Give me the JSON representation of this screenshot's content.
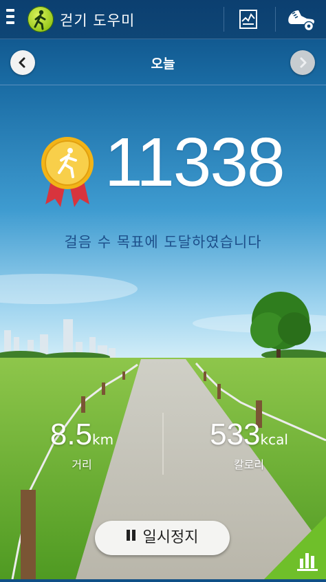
{
  "app": {
    "title": "걷기 도우미"
  },
  "header": {
    "icons": [
      "menu-icon",
      "walker-logo-icon",
      "report-icon",
      "shoe-settings-icon"
    ]
  },
  "date_nav": {
    "label": "오늘",
    "prev_icon": "chevron-left-icon",
    "next_icon": "chevron-right-icon"
  },
  "steps": {
    "count": "11338",
    "goal_message": "걸음 수 목표에 도달하였습니다"
  },
  "distance": {
    "value": "8.5",
    "unit": "km",
    "label": "거리"
  },
  "calories": {
    "value": "533",
    "unit": "kcal",
    "label": "칼로리"
  },
  "controls": {
    "pause_label": "일시정지",
    "stats_icon": "bar-chart-icon"
  },
  "colors": {
    "appbar": "#0e4676",
    "goal_text": "#1d4f8a",
    "grass": "#7fbf3a",
    "sky_top": "#1a6ca4",
    "sky_bottom": "#bfe3f3",
    "badge_green": "#6fbf2a"
  }
}
